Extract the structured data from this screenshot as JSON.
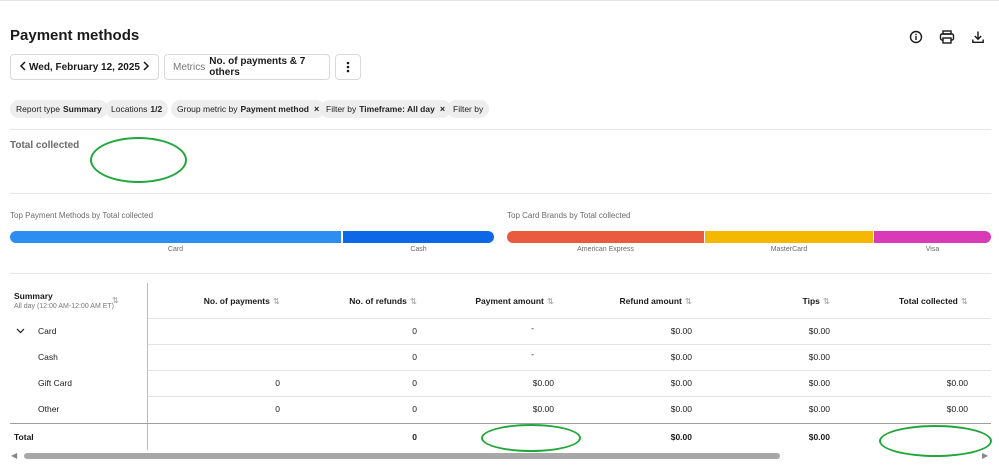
{
  "page": {
    "title": "Payment methods"
  },
  "header_icons": [
    "info-icon",
    "print-icon",
    "download-icon"
  ],
  "toolbar": {
    "date": "Wed, February 12, 2025",
    "metrics_label": "Metrics",
    "metrics_value": "No. of payments & 7 others"
  },
  "chips": [
    {
      "label": "Report type",
      "value": "Summary",
      "removable": false
    },
    {
      "label": "Locations",
      "value": "1/2",
      "removable": false
    },
    {
      "label": "Group metric by",
      "value": "Payment method",
      "removable": true
    },
    {
      "label": "Filter by",
      "value": "Timeframe: All day",
      "removable": true
    },
    {
      "label": "Filter by",
      "value": "",
      "removable": false
    }
  ],
  "summary": {
    "total_label": "Total collected"
  },
  "charts": [
    {
      "title": "Top Payment Methods by Total collected",
      "segments": [
        {
          "label": "Card",
          "share": 0.69,
          "color": "#2b8ef0"
        },
        {
          "label": "Cash",
          "share": 0.31,
          "color": "#0c68e6"
        }
      ]
    },
    {
      "title": "Top Card Brands by Total collected",
      "segments": [
        {
          "label": "American Express",
          "share": 0.4,
          "color": "#ea5a3f"
        },
        {
          "label": "MasterCard",
          "share": 0.35,
          "color": "#f5b800"
        },
        {
          "label": "Visa",
          "share": 0.25,
          "color": "#d93ab8"
        }
      ]
    }
  ],
  "table": {
    "summary_title": "Summary",
    "summary_sub": "All day (12:00 AM-12:00 AM ET)",
    "columns": [
      "No. of payments",
      "No. of refunds",
      "Payment amount",
      "Refund amount",
      "Tips",
      "Total collected"
    ],
    "rows": [
      {
        "label": "Card",
        "expandable": true,
        "cells": [
          "",
          "0",
          "-",
          "$0.00",
          "$0.00",
          ""
        ]
      },
      {
        "label": "Cash",
        "expandable": false,
        "cells": [
          "",
          "0",
          "-",
          "$0.00",
          "$0.00",
          ""
        ]
      },
      {
        "label": "Gift Card",
        "expandable": false,
        "cells": [
          "0",
          "0",
          "$0.00",
          "$0.00",
          "$0.00",
          "$0.00"
        ]
      },
      {
        "label": "Other",
        "expandable": false,
        "cells": [
          "0",
          "0",
          "$0.00",
          "$0.00",
          "$0.00",
          "$0.00"
        ]
      }
    ],
    "total": {
      "label": "Total",
      "cells": [
        "",
        "0",
        "",
        "$0.00",
        "$0.00",
        ""
      ]
    }
  },
  "colors": {
    "annotation": "#22a63c",
    "chip_bg": "#eeeeee"
  }
}
